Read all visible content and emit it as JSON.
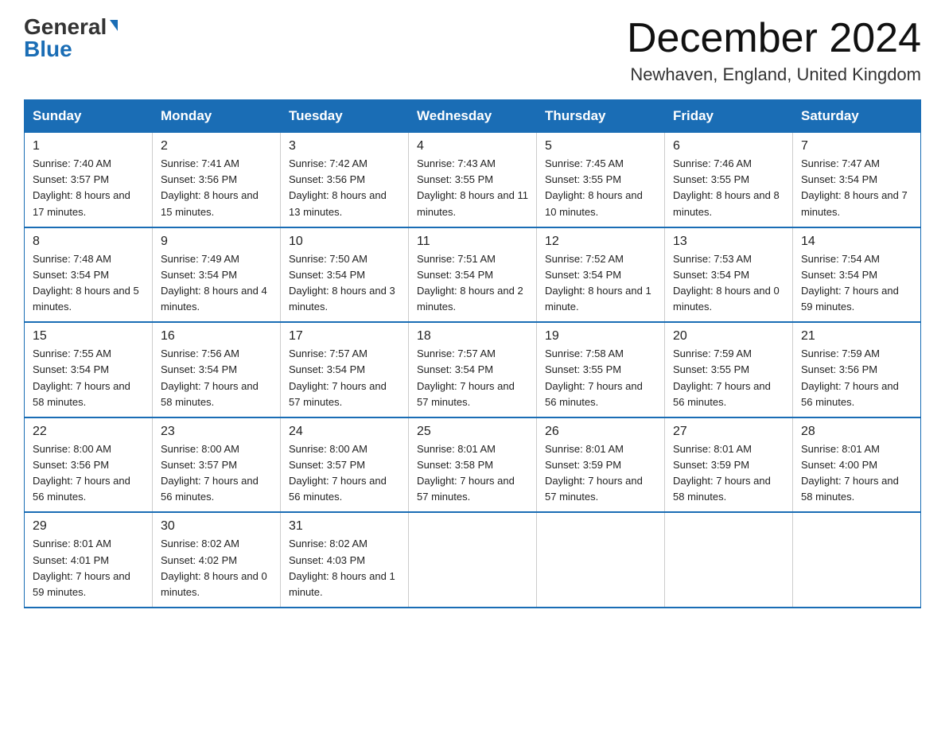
{
  "header": {
    "logo_general": "General",
    "logo_blue": "Blue",
    "month_title": "December 2024",
    "location": "Newhaven, England, United Kingdom"
  },
  "days_of_week": [
    "Sunday",
    "Monday",
    "Tuesday",
    "Wednesday",
    "Thursday",
    "Friday",
    "Saturday"
  ],
  "weeks": [
    [
      {
        "day": "1",
        "sunrise": "7:40 AM",
        "sunset": "3:57 PM",
        "daylight": "8 hours and 17 minutes."
      },
      {
        "day": "2",
        "sunrise": "7:41 AM",
        "sunset": "3:56 PM",
        "daylight": "8 hours and 15 minutes."
      },
      {
        "day": "3",
        "sunrise": "7:42 AM",
        "sunset": "3:56 PM",
        "daylight": "8 hours and 13 minutes."
      },
      {
        "day": "4",
        "sunrise": "7:43 AM",
        "sunset": "3:55 PM",
        "daylight": "8 hours and 11 minutes."
      },
      {
        "day": "5",
        "sunrise": "7:45 AM",
        "sunset": "3:55 PM",
        "daylight": "8 hours and 10 minutes."
      },
      {
        "day": "6",
        "sunrise": "7:46 AM",
        "sunset": "3:55 PM",
        "daylight": "8 hours and 8 minutes."
      },
      {
        "day": "7",
        "sunrise": "7:47 AM",
        "sunset": "3:54 PM",
        "daylight": "8 hours and 7 minutes."
      }
    ],
    [
      {
        "day": "8",
        "sunrise": "7:48 AM",
        "sunset": "3:54 PM",
        "daylight": "8 hours and 5 minutes."
      },
      {
        "day": "9",
        "sunrise": "7:49 AM",
        "sunset": "3:54 PM",
        "daylight": "8 hours and 4 minutes."
      },
      {
        "day": "10",
        "sunrise": "7:50 AM",
        "sunset": "3:54 PM",
        "daylight": "8 hours and 3 minutes."
      },
      {
        "day": "11",
        "sunrise": "7:51 AM",
        "sunset": "3:54 PM",
        "daylight": "8 hours and 2 minutes."
      },
      {
        "day": "12",
        "sunrise": "7:52 AM",
        "sunset": "3:54 PM",
        "daylight": "8 hours and 1 minute."
      },
      {
        "day": "13",
        "sunrise": "7:53 AM",
        "sunset": "3:54 PM",
        "daylight": "8 hours and 0 minutes."
      },
      {
        "day": "14",
        "sunrise": "7:54 AM",
        "sunset": "3:54 PM",
        "daylight": "7 hours and 59 minutes."
      }
    ],
    [
      {
        "day": "15",
        "sunrise": "7:55 AM",
        "sunset": "3:54 PM",
        "daylight": "7 hours and 58 minutes."
      },
      {
        "day": "16",
        "sunrise": "7:56 AM",
        "sunset": "3:54 PM",
        "daylight": "7 hours and 58 minutes."
      },
      {
        "day": "17",
        "sunrise": "7:57 AM",
        "sunset": "3:54 PM",
        "daylight": "7 hours and 57 minutes."
      },
      {
        "day": "18",
        "sunrise": "7:57 AM",
        "sunset": "3:54 PM",
        "daylight": "7 hours and 57 minutes."
      },
      {
        "day": "19",
        "sunrise": "7:58 AM",
        "sunset": "3:55 PM",
        "daylight": "7 hours and 56 minutes."
      },
      {
        "day": "20",
        "sunrise": "7:59 AM",
        "sunset": "3:55 PM",
        "daylight": "7 hours and 56 minutes."
      },
      {
        "day": "21",
        "sunrise": "7:59 AM",
        "sunset": "3:56 PM",
        "daylight": "7 hours and 56 minutes."
      }
    ],
    [
      {
        "day": "22",
        "sunrise": "8:00 AM",
        "sunset": "3:56 PM",
        "daylight": "7 hours and 56 minutes."
      },
      {
        "day": "23",
        "sunrise": "8:00 AM",
        "sunset": "3:57 PM",
        "daylight": "7 hours and 56 minutes."
      },
      {
        "day": "24",
        "sunrise": "8:00 AM",
        "sunset": "3:57 PM",
        "daylight": "7 hours and 56 minutes."
      },
      {
        "day": "25",
        "sunrise": "8:01 AM",
        "sunset": "3:58 PM",
        "daylight": "7 hours and 57 minutes."
      },
      {
        "day": "26",
        "sunrise": "8:01 AM",
        "sunset": "3:59 PM",
        "daylight": "7 hours and 57 minutes."
      },
      {
        "day": "27",
        "sunrise": "8:01 AM",
        "sunset": "3:59 PM",
        "daylight": "7 hours and 58 minutes."
      },
      {
        "day": "28",
        "sunrise": "8:01 AM",
        "sunset": "4:00 PM",
        "daylight": "7 hours and 58 minutes."
      }
    ],
    [
      {
        "day": "29",
        "sunrise": "8:01 AM",
        "sunset": "4:01 PM",
        "daylight": "7 hours and 59 minutes."
      },
      {
        "day": "30",
        "sunrise": "8:02 AM",
        "sunset": "4:02 PM",
        "daylight": "8 hours and 0 minutes."
      },
      {
        "day": "31",
        "sunrise": "8:02 AM",
        "sunset": "4:03 PM",
        "daylight": "8 hours and 1 minute."
      },
      null,
      null,
      null,
      null
    ]
  ]
}
